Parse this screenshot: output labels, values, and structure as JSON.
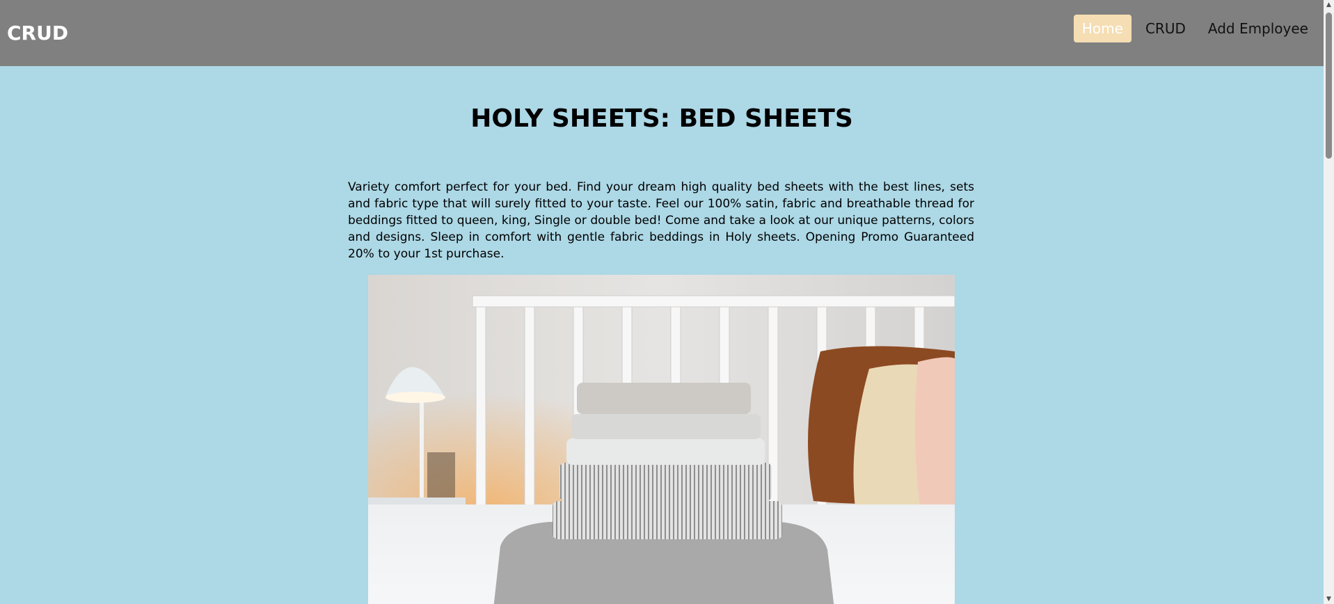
{
  "navbar": {
    "brand": "CRUD",
    "links": [
      {
        "label": "Home",
        "active": true
      },
      {
        "label": "CRUD",
        "active": false
      },
      {
        "label": "Add Employee",
        "active": false
      }
    ],
    "colors": {
      "background": "#808080",
      "active_background": "#f5deb3"
    }
  },
  "main": {
    "title": "HOLY SHEETS: BED SHEETS",
    "description": "Variety comfort perfect for your bed. Find your dream high quality bed sheets with the best lines, sets and fabric type that will surely fitted to your taste. Feel our 100% satin, fabric and breathable thread for beddings fitted to queen, king, Single or double bed! Come and take a look at our unique patterns, colors and designs. Sleep in comfort with gentle fabric beddings in Holy sheets. Opening Promo Guaranteed 20% to your 1st purchase.",
    "background_color": "#add8e6"
  },
  "scrollbar": {
    "up_icon": "scroll-up-icon",
    "down_icon": "scroll-down-icon"
  }
}
